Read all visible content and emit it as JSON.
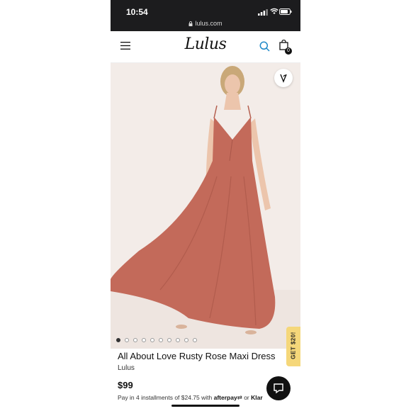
{
  "status_bar": {
    "time": "10:54",
    "url": "lulus.com"
  },
  "nav": {
    "logo_text": "Lulus",
    "cart_count": "0",
    "icons": [
      "menu-icon",
      "search-icon",
      "bag-icon"
    ]
  },
  "product": {
    "image_description_icon": "product-photo",
    "wishlist_icon": "heart-v-icon",
    "carousel": {
      "total": 10,
      "active_index": 0
    },
    "title": "All About Love Rusty Rose Maxi Dress",
    "brand": "Lulus",
    "price": "$99",
    "installments_prefix": "Pay in 4 installments of $24.75 with",
    "afterpay_label": "afterpay",
    "or_label": "or",
    "klarna_label": "Klar"
  },
  "promo": {
    "get20_label": "GET $20!"
  },
  "colors": {
    "dress": "#c36a5a",
    "accent_blue": "#1e88c8",
    "promo_yellow": "#f5d77a",
    "status_bar_bg": "#1c1c1e"
  }
}
